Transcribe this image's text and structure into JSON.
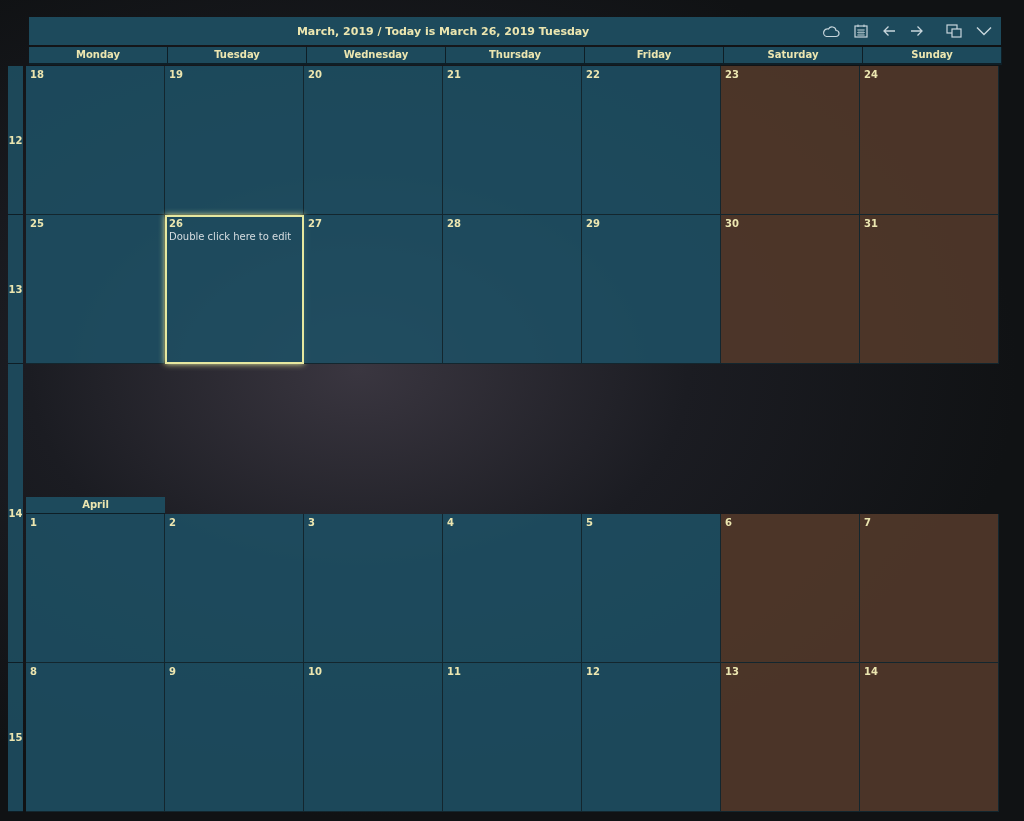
{
  "header": {
    "title": "March, 2019 / Today is March 26, 2019 Tuesday"
  },
  "weekdays": [
    {
      "label": "Monday"
    },
    {
      "label": "Tuesday"
    },
    {
      "label": "Wednesday"
    },
    {
      "label": "Thursday"
    },
    {
      "label": "Friday"
    },
    {
      "label": "Saturday"
    },
    {
      "label": "Sunday"
    }
  ],
  "weeks": [
    {
      "number": "12"
    },
    {
      "number": "13"
    },
    {
      "number": "14"
    },
    {
      "number": "15"
    }
  ],
  "months": [
    {
      "rows": [
        [
          {
            "day": "18",
            "weekend": false,
            "selected": false
          },
          {
            "day": "19",
            "weekend": false,
            "selected": false
          },
          {
            "day": "20",
            "weekend": false,
            "selected": false
          },
          {
            "day": "21",
            "weekend": false,
            "selected": false
          },
          {
            "day": "22",
            "weekend": false,
            "selected": false
          },
          {
            "day": "23",
            "weekend": true,
            "selected": false
          },
          {
            "day": "24",
            "weekend": true,
            "selected": false
          }
        ],
        [
          {
            "day": "25",
            "weekend": false,
            "selected": false
          },
          {
            "day": "26",
            "weekend": false,
            "selected": true,
            "note": "Double click here to edit"
          },
          {
            "day": "27",
            "weekend": false,
            "selected": false
          },
          {
            "day": "28",
            "weekend": false,
            "selected": false
          },
          {
            "day": "29",
            "weekend": false,
            "selected": false
          },
          {
            "day": "30",
            "weekend": true,
            "selected": false
          },
          {
            "day": "31",
            "weekend": true,
            "selected": false
          }
        ]
      ]
    },
    {
      "label": "April",
      "rows": [
        [
          {
            "day": "1",
            "weekend": false,
            "selected": false
          },
          {
            "day": "2",
            "weekend": false,
            "selected": false
          },
          {
            "day": "3",
            "weekend": false,
            "selected": false
          },
          {
            "day": "4",
            "weekend": false,
            "selected": false
          },
          {
            "day": "5",
            "weekend": false,
            "selected": false
          },
          {
            "day": "6",
            "weekend": true,
            "selected": false
          },
          {
            "day": "7",
            "weekend": true,
            "selected": false
          }
        ],
        [
          {
            "day": "8",
            "weekend": false,
            "selected": false
          },
          {
            "day": "9",
            "weekend": false,
            "selected": false
          },
          {
            "day": "10",
            "weekend": false,
            "selected": false
          },
          {
            "day": "11",
            "weekend": false,
            "selected": false
          },
          {
            "day": "12",
            "weekend": false,
            "selected": false
          },
          {
            "day": "13",
            "weekend": true,
            "selected": false
          },
          {
            "day": "14",
            "weekend": true,
            "selected": false
          }
        ]
      ]
    }
  ]
}
